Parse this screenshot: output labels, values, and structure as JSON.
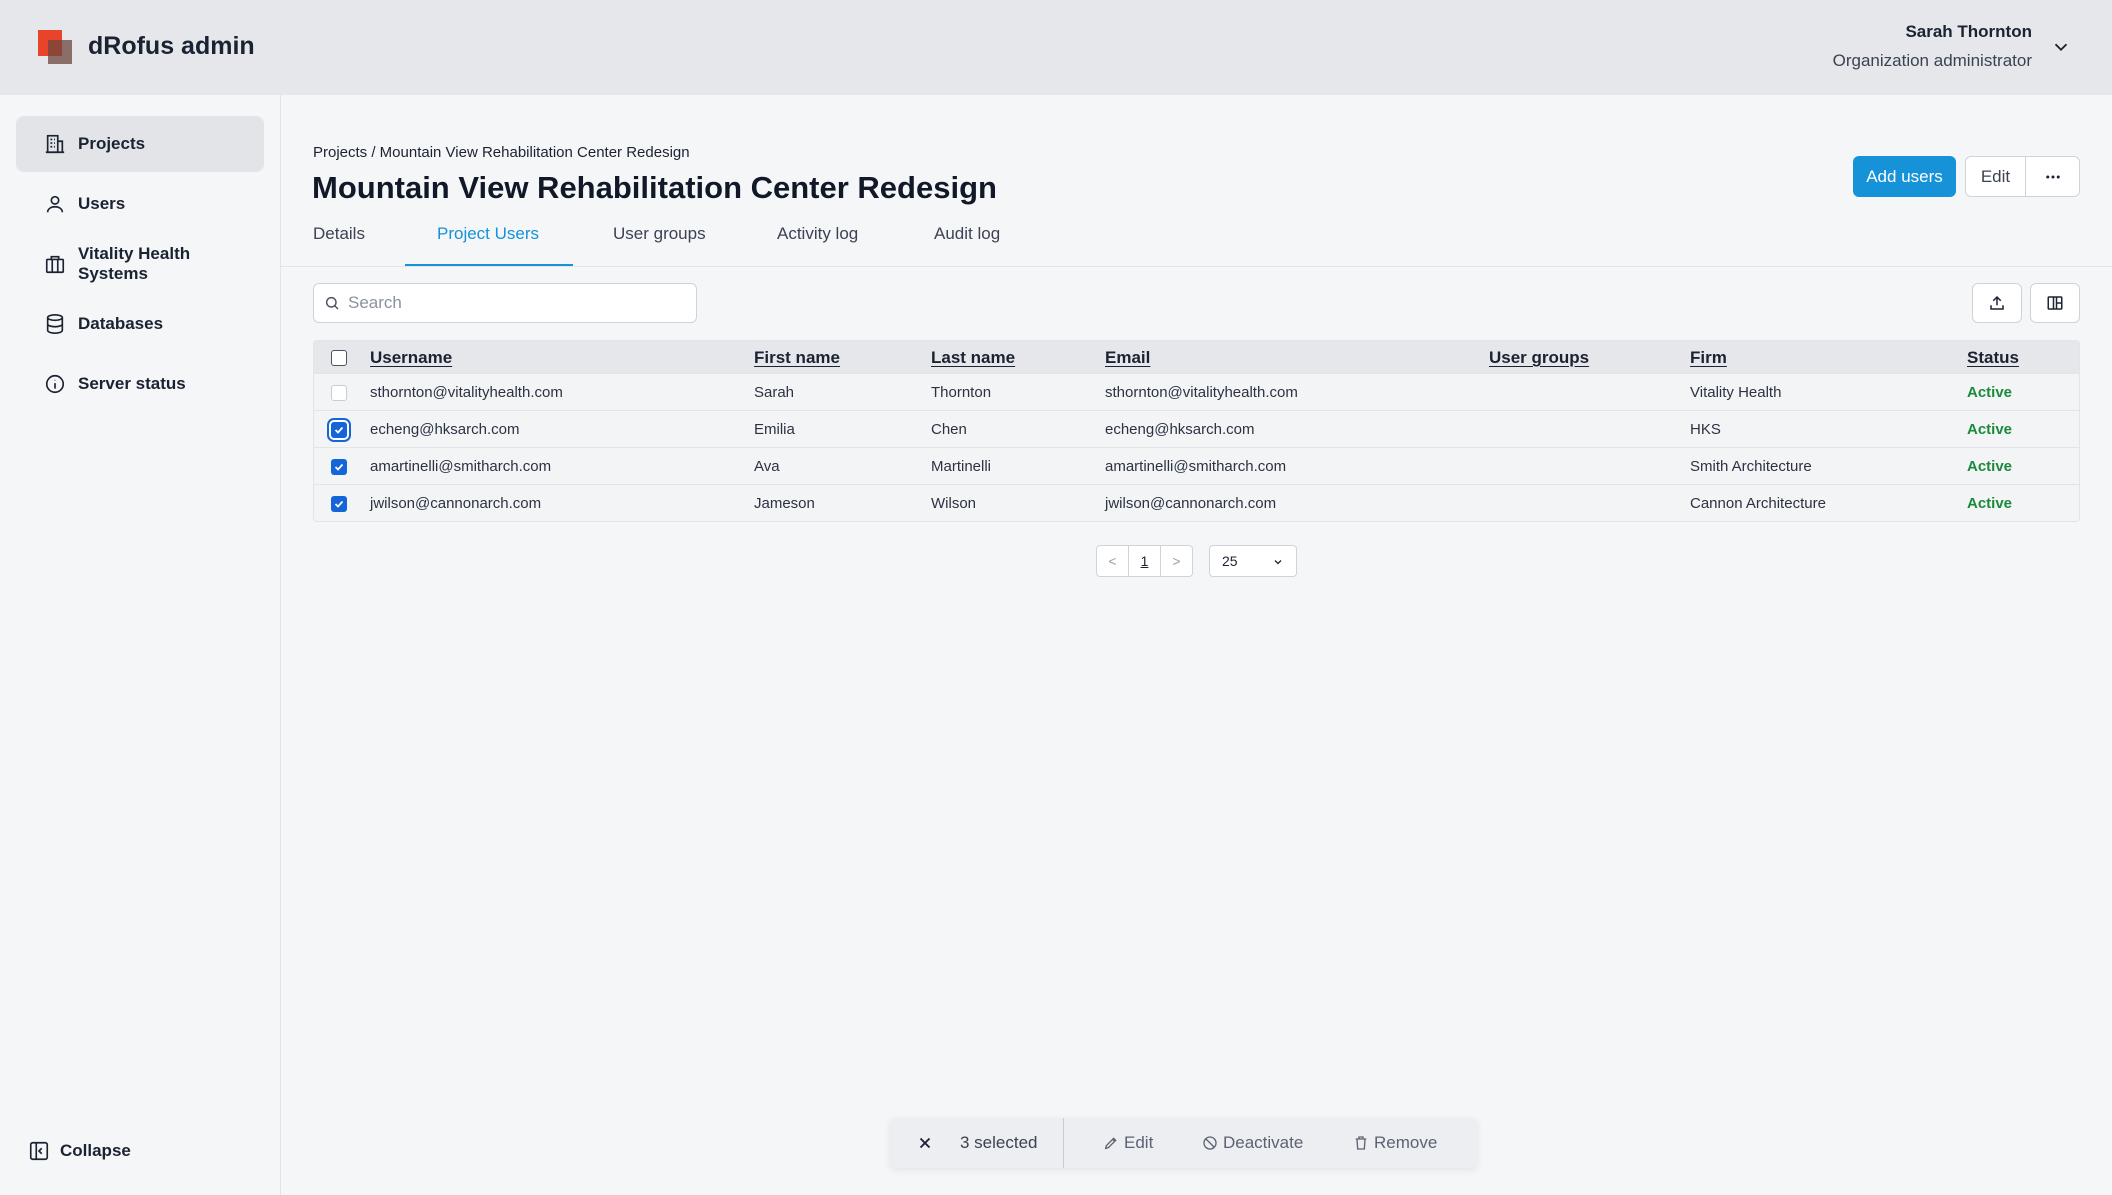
{
  "app": {
    "title": "dRofus admin"
  },
  "user": {
    "name": "Sarah Thornton",
    "role": "Organization administrator"
  },
  "sidebar": {
    "items": [
      {
        "label": "Projects",
        "icon": "building-icon"
      },
      {
        "label": "Users",
        "icon": "user-icon"
      },
      {
        "label": "Vitality Health Systems",
        "icon": "organization-icon"
      },
      {
        "label": "Databases",
        "icon": "database-icon"
      },
      {
        "label": "Server status",
        "icon": "info-icon"
      }
    ],
    "collapse_label": "Collapse"
  },
  "breadcrumb": "Projects / Mountain View Rehabilitation Center Redesign",
  "page_title": "Mountain View Rehabilitation Center Redesign",
  "actions": {
    "add_users": "Add users",
    "edit": "Edit"
  },
  "tabs": [
    "Details",
    "Project Users",
    "User groups",
    "Activity log",
    "Audit log"
  ],
  "active_tab": "Project Users",
  "search": {
    "placeholder": "Search",
    "value": ""
  },
  "table": {
    "columns": [
      "Username",
      "First name",
      "Last name",
      "Email",
      "User groups",
      "Firm",
      "Status"
    ],
    "rows": [
      {
        "checked": false,
        "username": "sthornton@vitalityhealth.com",
        "first": "Sarah",
        "last": "Thornton",
        "email": "sthornton@vitalityhealth.com",
        "groups": "",
        "firm": "Vitality Health",
        "status": "Active"
      },
      {
        "checked": true,
        "username": "echeng@hksarch.com",
        "first": "Emilia",
        "last": "Chen",
        "email": "echeng@hksarch.com",
        "groups": "",
        "firm": "HKS",
        "status": "Active"
      },
      {
        "checked": true,
        "username": "amartinelli@smitharch.com",
        "first": "Ava",
        "last": "Martinelli",
        "email": "amartinelli@smitharch.com",
        "groups": "",
        "firm": "Smith Architecture",
        "status": "Active"
      },
      {
        "checked": true,
        "username": "jwilson@cannonarch.com",
        "first": "Jameson",
        "last": "Wilson",
        "email": "jwilson@cannonarch.com",
        "groups": "",
        "firm": "Cannon Architecture",
        "status": "Active"
      }
    ]
  },
  "pagination": {
    "prev": "<",
    "page": "1",
    "next": ">",
    "page_size": "25"
  },
  "bulk": {
    "selected": "3 selected",
    "edit": "Edit",
    "deactivate": "Deactivate",
    "remove": "Remove"
  },
  "colors": {
    "accent": "#1592d8",
    "active_status": "#1b8a3c",
    "checkbox": "#1565d8",
    "brand": "#e8442b"
  }
}
